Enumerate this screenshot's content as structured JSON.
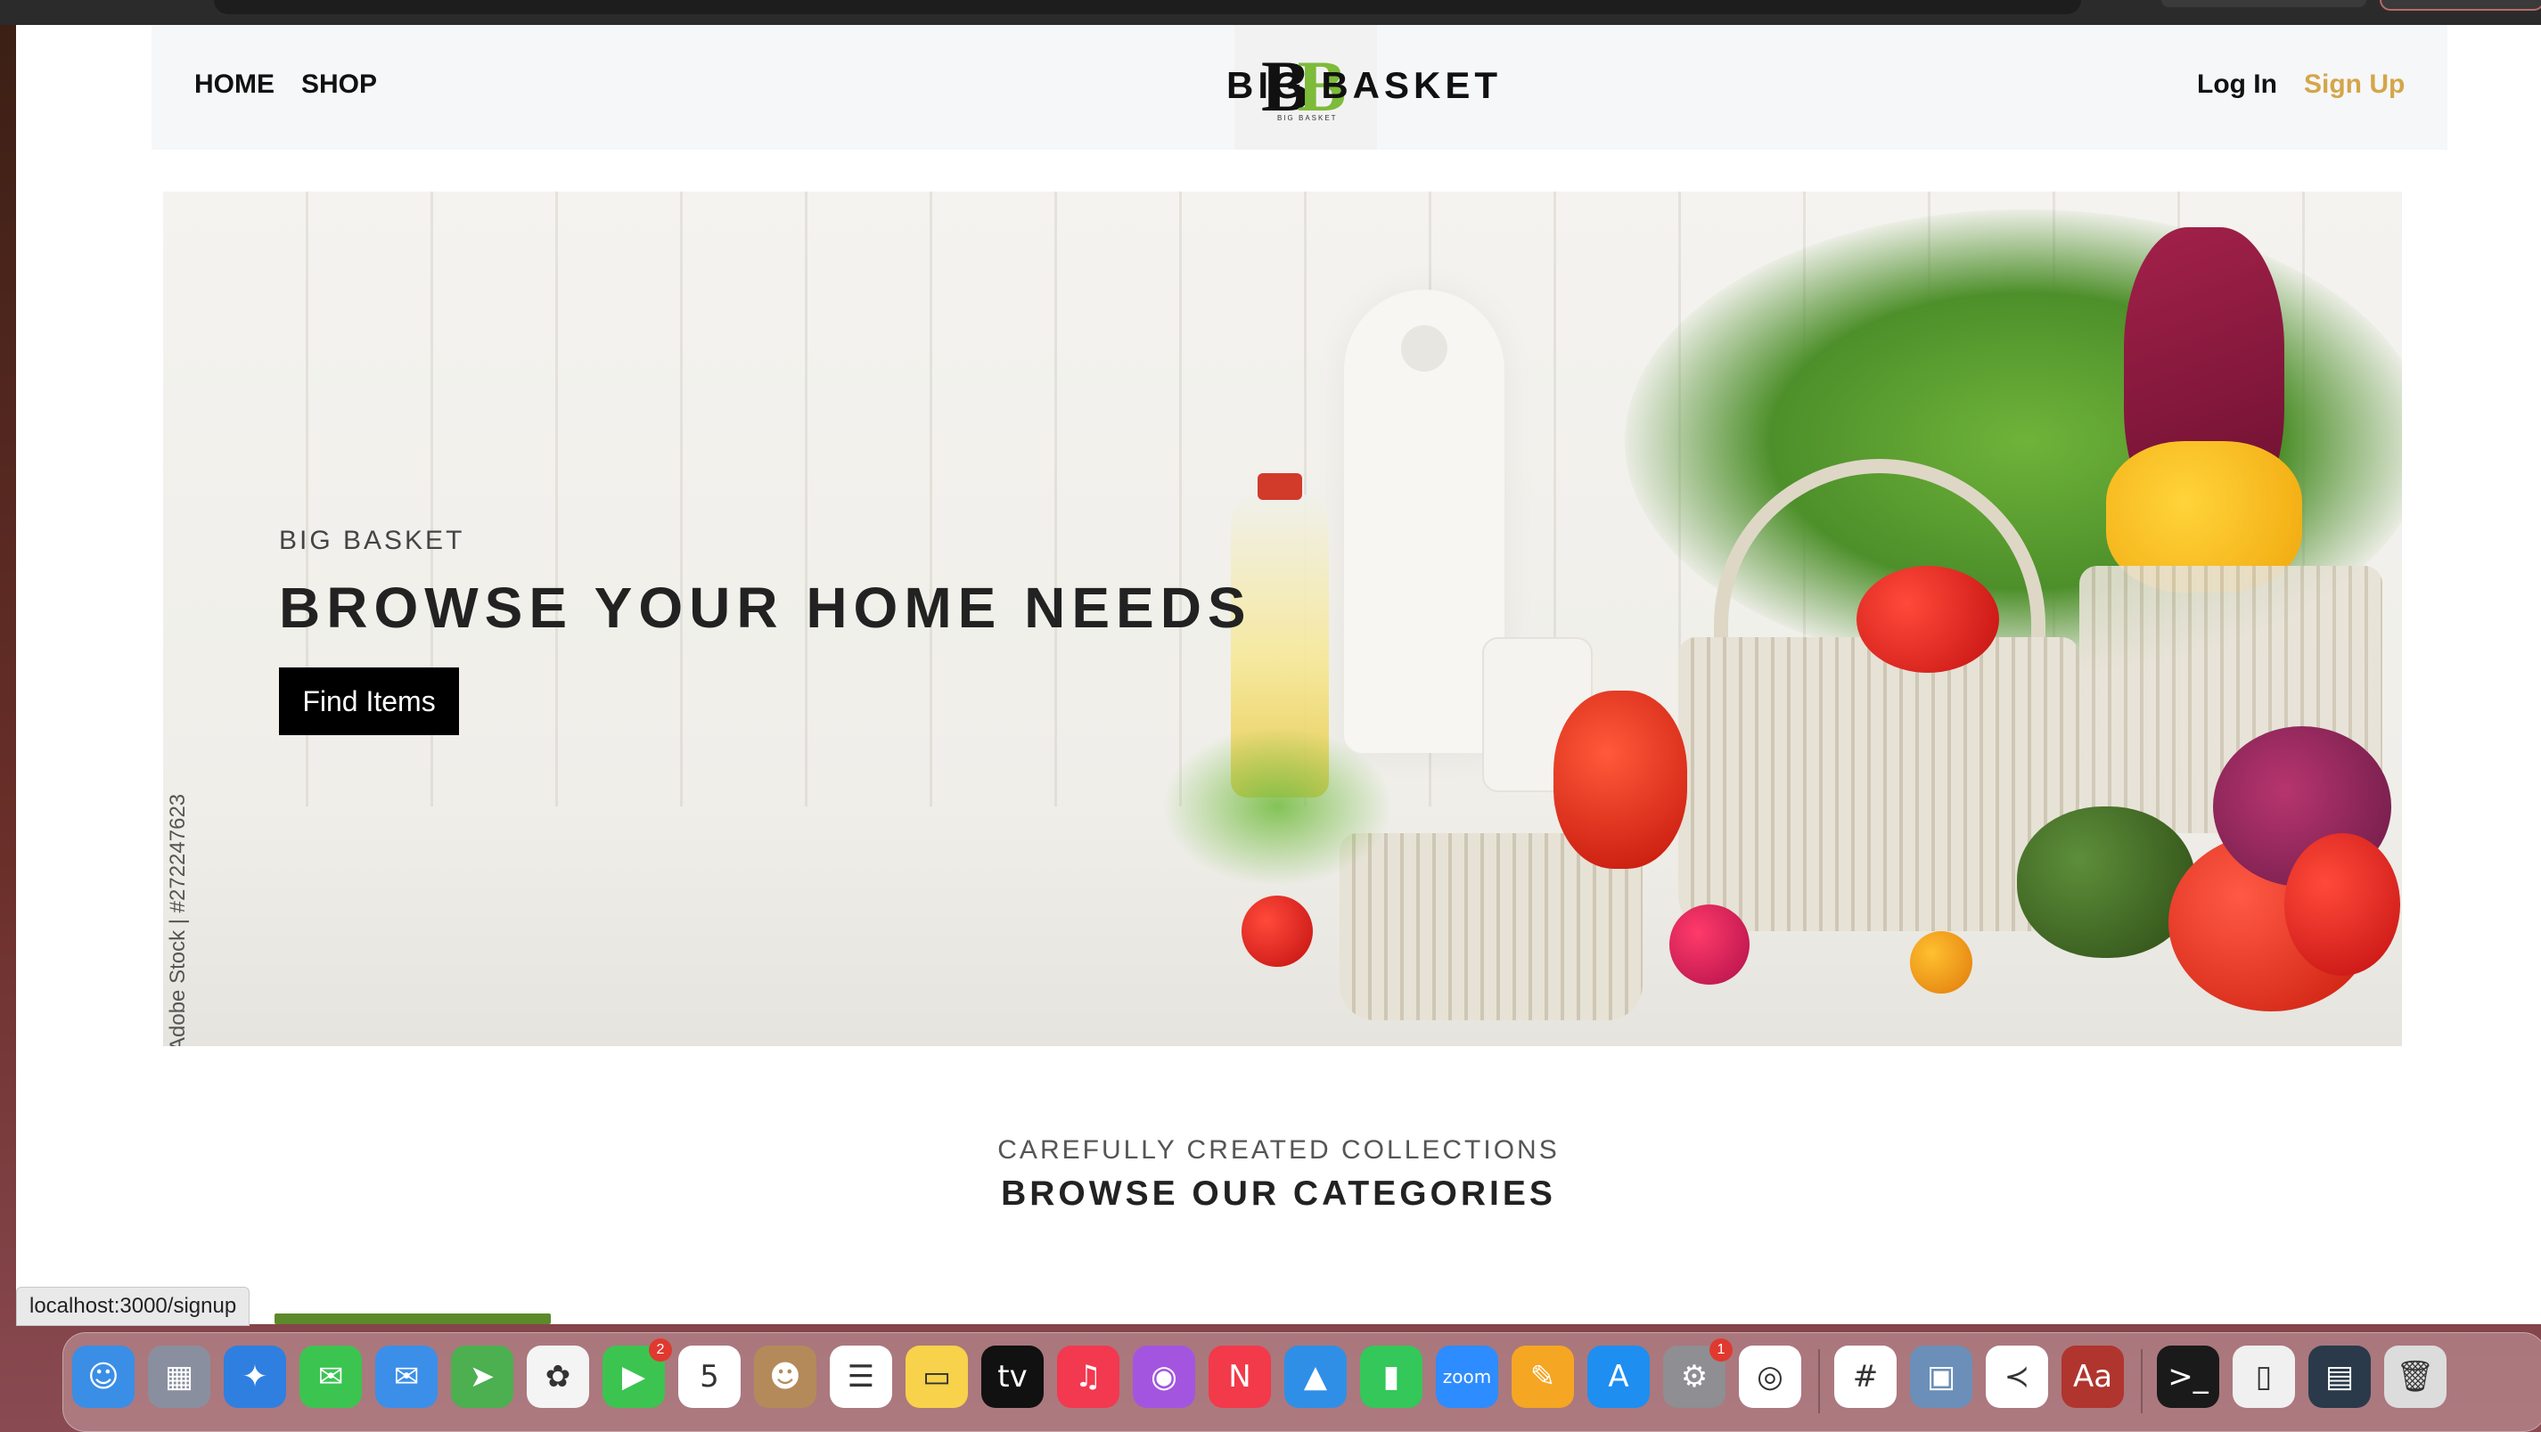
{
  "nav": {
    "links": [
      "HOME",
      "SHOP"
    ],
    "brand": "BIG BASKET",
    "logo_letters": "BB",
    "logo_tagline": "BIG BASKET",
    "login": "Log In",
    "signup": "Sign Up",
    "signup_color": "#d4a64a"
  },
  "hero": {
    "eyebrow": "BIG BASKET",
    "headline": "BROWSE YOUR HOME NEEDS",
    "cta": "Find Items",
    "credit": "Adobe Stock | #272247623"
  },
  "section": {
    "eyebrow": "CAREFULLY CREATED COLLECTIONS",
    "title": "BROWSE OUR CATEGORIES"
  },
  "status_bar": {
    "url": "localhost:3000/signup"
  },
  "dock": {
    "items": [
      {
        "name": "finder-icon",
        "glyph": "☺",
        "color": "#3a8ee6"
      },
      {
        "name": "launchpad-icon",
        "glyph": "▦",
        "color": "#8a8fa0"
      },
      {
        "name": "safari-icon",
        "glyph": "✦",
        "color": "#2f7fe0"
      },
      {
        "name": "messages-icon",
        "glyph": "✉",
        "color": "#3cc450"
      },
      {
        "name": "mail-icon",
        "glyph": "✉",
        "color": "#3b8fe8"
      },
      {
        "name": "maps-icon",
        "glyph": "➤",
        "color": "#4caf50"
      },
      {
        "name": "photos-icon",
        "glyph": "✿",
        "color": "#f4f4f4"
      },
      {
        "name": "facetime-icon",
        "glyph": "▶",
        "color": "#3cc450",
        "badge": "2"
      },
      {
        "name": "calendar-icon",
        "glyph": "5",
        "color": "#ffffff"
      },
      {
        "name": "contacts-icon",
        "glyph": "☻",
        "color": "#b58a5a"
      },
      {
        "name": "reminders-icon",
        "glyph": "☰",
        "color": "#ffffff"
      },
      {
        "name": "notes-icon",
        "glyph": "▭",
        "color": "#f7d24a"
      },
      {
        "name": "apple-tv-icon",
        "glyph": "tv",
        "color": "#111111"
      },
      {
        "name": "music-icon",
        "glyph": "♫",
        "color": "#f2394f"
      },
      {
        "name": "podcasts-icon",
        "glyph": "◉",
        "color": "#a455e0"
      },
      {
        "name": "news-icon",
        "glyph": "N",
        "color": "#f23a4a"
      },
      {
        "name": "keynote-icon",
        "glyph": "▲",
        "color": "#2f8fe6"
      },
      {
        "name": "numbers-icon",
        "glyph": "▮",
        "color": "#34c759"
      },
      {
        "name": "zoom-icon",
        "glyph": "zoom",
        "color": "#2d8cff"
      },
      {
        "name": "pages-icon",
        "glyph": "✎",
        "color": "#f5a623"
      },
      {
        "name": "app-store-icon",
        "glyph": "A",
        "color": "#1e8ef0"
      },
      {
        "name": "system-preferences-icon",
        "glyph": "⚙",
        "color": "#8e8e93",
        "badge": "1"
      },
      {
        "name": "chrome-icon",
        "glyph": "◎",
        "color": "#ffffff"
      },
      {
        "name": "slack-icon",
        "glyph": "#",
        "color": "#ffffff"
      },
      {
        "name": "preview-icon",
        "glyph": "▣",
        "color": "#6b8fb8"
      },
      {
        "name": "vscode-icon",
        "glyph": "≺",
        "color": "#ffffff"
      },
      {
        "name": "dictionary-icon",
        "glyph": "Aa",
        "color": "#b0352e"
      },
      {
        "name": "terminal-icon",
        "glyph": ">_",
        "color": "#1a1a1a"
      },
      {
        "name": "archive-icon",
        "glyph": "▯",
        "color": "#f0f0f0"
      },
      {
        "name": "window-thumbnail-icon",
        "glyph": "▤",
        "color": "#2a3a4a"
      },
      {
        "name": "trash-icon",
        "glyph": "🗑",
        "color": "#dcdcdc"
      }
    ]
  }
}
